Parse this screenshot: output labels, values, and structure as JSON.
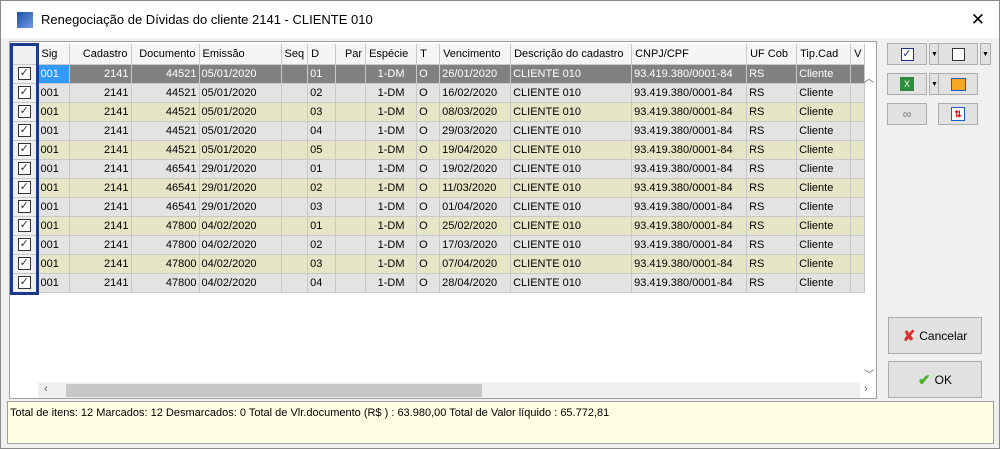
{
  "window": {
    "title": "Renegociação de Dívidas do cliente 2141 - CLIENTE 010",
    "close": "✕"
  },
  "grid": {
    "columns": [
      "",
      "Sig",
      "Cadastro",
      "Documento",
      "Emissão",
      "Seq",
      "D",
      "Par",
      "Espécie",
      "T",
      "Vencimento",
      "Descrição do cadastro",
      "CNPJ/CPF",
      "UF Cob",
      "Tip.Cad",
      "V"
    ],
    "rows": [
      {
        "checked": true,
        "sig": "001",
        "cadastro": "2141",
        "documento": "44521",
        "emissao": "05/01/2020",
        "seq": "",
        "d": "01",
        "par": "",
        "especie": "1-DM",
        "t": "O",
        "vencimento": "26/01/2020",
        "descricao": "CLIENTE 010",
        "cnpj": "93.419.380/0001-84",
        "uf": "RS",
        "tip": "Cliente"
      },
      {
        "checked": true,
        "sig": "001",
        "cadastro": "2141",
        "documento": "44521",
        "emissao": "05/01/2020",
        "seq": "",
        "d": "02",
        "par": "",
        "especie": "1-DM",
        "t": "O",
        "vencimento": "16/02/2020",
        "descricao": "CLIENTE 010",
        "cnpj": "93.419.380/0001-84",
        "uf": "RS",
        "tip": "Cliente"
      },
      {
        "checked": true,
        "sig": "001",
        "cadastro": "2141",
        "documento": "44521",
        "emissao": "05/01/2020",
        "seq": "",
        "d": "03",
        "par": "",
        "especie": "1-DM",
        "t": "O",
        "vencimento": "08/03/2020",
        "descricao": "CLIENTE 010",
        "cnpj": "93.419.380/0001-84",
        "uf": "RS",
        "tip": "Cliente"
      },
      {
        "checked": true,
        "sig": "001",
        "cadastro": "2141",
        "documento": "44521",
        "emissao": "05/01/2020",
        "seq": "",
        "d": "04",
        "par": "",
        "especie": "1-DM",
        "t": "O",
        "vencimento": "29/03/2020",
        "descricao": "CLIENTE 010",
        "cnpj": "93.419.380/0001-84",
        "uf": "RS",
        "tip": "Cliente"
      },
      {
        "checked": true,
        "sig": "001",
        "cadastro": "2141",
        "documento": "44521",
        "emissao": "05/01/2020",
        "seq": "",
        "d": "05",
        "par": "",
        "especie": "1-DM",
        "t": "O",
        "vencimento": "19/04/2020",
        "descricao": "CLIENTE 010",
        "cnpj": "93.419.380/0001-84",
        "uf": "RS",
        "tip": "Cliente"
      },
      {
        "checked": true,
        "sig": "001",
        "cadastro": "2141",
        "documento": "46541",
        "emissao": "29/01/2020",
        "seq": "",
        "d": "01",
        "par": "",
        "especie": "1-DM",
        "t": "O",
        "vencimento": "19/02/2020",
        "descricao": "CLIENTE 010",
        "cnpj": "93.419.380/0001-84",
        "uf": "RS",
        "tip": "Cliente"
      },
      {
        "checked": true,
        "sig": "001",
        "cadastro": "2141",
        "documento": "46541",
        "emissao": "29/01/2020",
        "seq": "",
        "d": "02",
        "par": "",
        "especie": "1-DM",
        "t": "O",
        "vencimento": "11/03/2020",
        "descricao": "CLIENTE 010",
        "cnpj": "93.419.380/0001-84",
        "uf": "RS",
        "tip": "Cliente"
      },
      {
        "checked": true,
        "sig": "001",
        "cadastro": "2141",
        "documento": "46541",
        "emissao": "29/01/2020",
        "seq": "",
        "d": "03",
        "par": "",
        "especie": "1-DM",
        "t": "O",
        "vencimento": "01/04/2020",
        "descricao": "CLIENTE 010",
        "cnpj": "93.419.380/0001-84",
        "uf": "RS",
        "tip": "Cliente"
      },
      {
        "checked": true,
        "sig": "001",
        "cadastro": "2141",
        "documento": "47800",
        "emissao": "04/02/2020",
        "seq": "",
        "d": "01",
        "par": "",
        "especie": "1-DM",
        "t": "O",
        "vencimento": "25/02/2020",
        "descricao": "CLIENTE 010",
        "cnpj": "93.419.380/0001-84",
        "uf": "RS",
        "tip": "Cliente"
      },
      {
        "checked": true,
        "sig": "001",
        "cadastro": "2141",
        "documento": "47800",
        "emissao": "04/02/2020",
        "seq": "",
        "d": "02",
        "par": "",
        "especie": "1-DM",
        "t": "O",
        "vencimento": "17/03/2020",
        "descricao": "CLIENTE 010",
        "cnpj": "93.419.380/0001-84",
        "uf": "RS",
        "tip": "Cliente"
      },
      {
        "checked": true,
        "sig": "001",
        "cadastro": "2141",
        "documento": "47800",
        "emissao": "04/02/2020",
        "seq": "",
        "d": "03",
        "par": "",
        "especie": "1-DM",
        "t": "O",
        "vencimento": "07/04/2020",
        "descricao": "CLIENTE 010",
        "cnpj": "93.419.380/0001-84",
        "uf": "RS",
        "tip": "Cliente"
      },
      {
        "checked": true,
        "sig": "001",
        "cadastro": "2141",
        "documento": "47800",
        "emissao": "04/02/2020",
        "seq": "",
        "d": "04",
        "par": "",
        "especie": "1-DM",
        "t": "O",
        "vencimento": "28/04/2020",
        "descricao": "CLIENTE 010",
        "cnpj": "93.419.380/0001-84",
        "uf": "RS",
        "tip": "Cliente"
      }
    ]
  },
  "buttons": {
    "cancel": "Cancelar",
    "ok": "OK"
  },
  "status": "Total de itens: 12 Marcados: 12 Desmarcados: 0 Total de Vlr.documento (R$ ) : 63.980,00 Total de Valor líquido : 65.772,81",
  "colors": {
    "selected_row": "#818181",
    "row_gray": "#e3e3e3",
    "row_beige": "#e6e6c6",
    "checkbox_frame": "#1b3a8c",
    "status_bg": "#ffffe6"
  }
}
